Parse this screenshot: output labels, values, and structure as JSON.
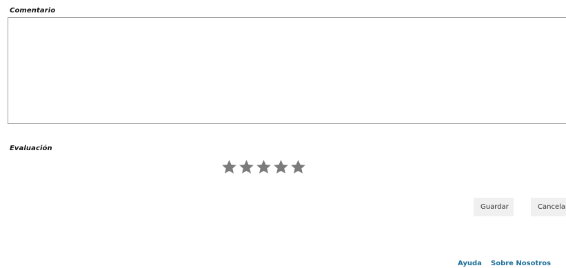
{
  "form": {
    "comment_label": "Comentario",
    "comment_value": "",
    "rating_label": "Evaluación",
    "rating": {
      "value": 0,
      "max": 5,
      "star_color": "#7b7b7b"
    },
    "save_label": "Guardar",
    "cancel_label": "Cancelar"
  },
  "footer": {
    "links": [
      {
        "label": "Ayuda",
        "color": "#1d6e9a"
      },
      {
        "label": "Sobre Nosotros",
        "color": "#1d6e9a"
      }
    ]
  }
}
